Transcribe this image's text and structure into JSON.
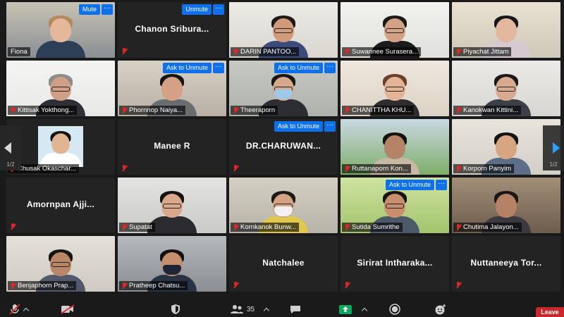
{
  "tiles": [
    {
      "name": "Fiona",
      "buttons": [
        "Mute"
      ],
      "video": true,
      "bg": "#8a8f93",
      "wall": "#c8c3b4",
      "skin": "#e6b89b",
      "hair": "#b38b5d",
      "shirt": "#2d3e57"
    },
    {
      "name": "Chanon  Sribura...",
      "buttons": [
        "Unmute"
      ],
      "video": false
    },
    {
      "name": "DARIN PANTOO...",
      "video": true,
      "bg": "#d9d6cf",
      "wall": "#ecebe6",
      "skin": "#d09a7b",
      "hair": "#1d1b1a",
      "shirt": "#3b4c7a",
      "glasses": true
    },
    {
      "name": "Suwannee Surasera...",
      "video": true,
      "active": true,
      "bg": "#dfe0dc",
      "wall": "#f3f2ee",
      "skin": "#d3a286",
      "hair": "#1b1918",
      "shirt": "#1b1b1e",
      "glasses": true
    },
    {
      "name": "Piyachat Jittam",
      "video": true,
      "bg": "#cfc7b7",
      "wall": "#e9e1d1",
      "skin": "#e2b89f",
      "hair": "#18171a",
      "shirt": "#d6c9cf"
    },
    {
      "name": "Kittisak Yokthong...",
      "video": true,
      "bg": "#e8e8e6",
      "wall": "#f4f4f2",
      "skin": "#cf9f86",
      "hair": "#8c8c8c",
      "shirt": "#2f2f35",
      "glasses": true
    },
    {
      "name": "Phornnop Naiya...",
      "buttons": [
        "Ask to Unmute"
      ],
      "video": true,
      "bg": "#b8b0a4",
      "wall": "#d7d1c7",
      "skin": "#d4a184",
      "hair": "#151414",
      "shirt": "#6a6c70"
    },
    {
      "name": "Theeraporn",
      "buttons": [
        "Ask to Unmute"
      ],
      "video": true,
      "bg": "#aeb1ac",
      "wall": "#c7c9c3",
      "skin": "#d6a98c",
      "hair": "#171718",
      "shirt": "#2c2e34",
      "mask": "#9ec9ea",
      "glasses": true
    },
    {
      "name": "CHANITTHA KHU...",
      "video": true,
      "bg": "#dcd2c6",
      "wall": "#efe8de",
      "skin": "#e4b497",
      "hair": "#6e3f2c",
      "shirt": "#2e2c2e",
      "glasses": true
    },
    {
      "name": "Kanokwan Kittini...",
      "video": true,
      "bg": "#d8d6d2",
      "wall": "#eceae6",
      "skin": "#d8aa8f",
      "hair": "#1c1a19",
      "shirt": "#3d3f47",
      "glasses": true
    },
    {
      "name": "Chusak Okaschar...",
      "video": true,
      "photo": true,
      "bg": "#232323",
      "wall": "#d6e8f1",
      "skin": "#e1b593",
      "hair": "#141414",
      "shirt": "#ffffff"
    },
    {
      "name": "Manee R",
      "video": false
    },
    {
      "name": "DR.CHARUWAN...",
      "buttons": [
        "Ask to Unmute"
      ],
      "video": false
    },
    {
      "name": "Ruttanaporn Kon...",
      "video": true,
      "bg": "#7fae6a",
      "wall": "#c9d8e3",
      "skin": "#b58365",
      "hair": "#151312",
      "shirt": "#c7b9a6"
    },
    {
      "name": "Korporn Panyim",
      "video": true,
      "bg": "#d3cfc7",
      "wall": "#e8e4dc",
      "skin": "#d7a57f",
      "hair": "#141313",
      "shirt": "#5e6e86"
    },
    {
      "name": "Amornpan  Ajji...",
      "video": false
    },
    {
      "name": "Supatat",
      "video": true,
      "bg": "#cacbc8",
      "wall": "#e3e4e1",
      "skin": "#d9a88b",
      "hair": "#141414",
      "shirt": "#2b2b2f",
      "glasses": true
    },
    {
      "name": "Kornkanok Bunw...",
      "video": true,
      "bg": "#b8b3a8",
      "wall": "#d4cfc3",
      "skin": "#d3a383",
      "hair": "#1b1a19",
      "shirt": "#e0c84e",
      "mask": "#f1f1f1",
      "glasses": true
    },
    {
      "name": "Sutida Sumrithe",
      "buttons": [
        "Ask to Unmute"
      ],
      "video": true,
      "bg": "#a3c46d",
      "wall": "#cfe3a0",
      "skin": "#c98f6c",
      "hair": "#161515",
      "shirt": "#4b5969",
      "glasses": true
    },
    {
      "name": "Chutima Jalayon...",
      "video": true,
      "bg": "#6c5c4c",
      "wall": "#a38f78",
      "skin": "#b58266",
      "hair": "#1b1716",
      "shirt": "#3c3a40"
    },
    {
      "name": "Benjaphorn Prap...",
      "video": true,
      "bg": "#cfcbc3",
      "wall": "#e4e0d8",
      "skin": "#b98767",
      "hair": "#171514",
      "shirt": "#51596b",
      "glasses": true
    },
    {
      "name": "Pratheep Chatsu...",
      "video": true,
      "bg": "#8b8e93",
      "wall": "#b5b8bd",
      "skin": "#c58e6e",
      "hair": "#111111",
      "shirt": "#283446",
      "mask": "#1c2638"
    },
    {
      "name": "Natchalee",
      "video": false
    },
    {
      "name": "Sirirat  Intharaka...",
      "video": false
    },
    {
      "name": "Nuttaneeya  Tor...",
      "video": false
    }
  ],
  "pager": {
    "left": "1/2",
    "right": "1/2"
  },
  "toolbar": {
    "participants_count": "35",
    "leave_label": "Leave"
  },
  "icons": [
    "mic-muted-icon",
    "video-off-icon",
    "security-shield-icon",
    "participants-icon",
    "chat-icon",
    "share-screen-icon",
    "record-icon",
    "reactions-icon"
  ],
  "colors": {
    "accent": "#0e71eb",
    "active_speaker": "#c6e24b",
    "muted": "#e02828",
    "leave": "#c7272d",
    "share": "#0ca85e"
  }
}
